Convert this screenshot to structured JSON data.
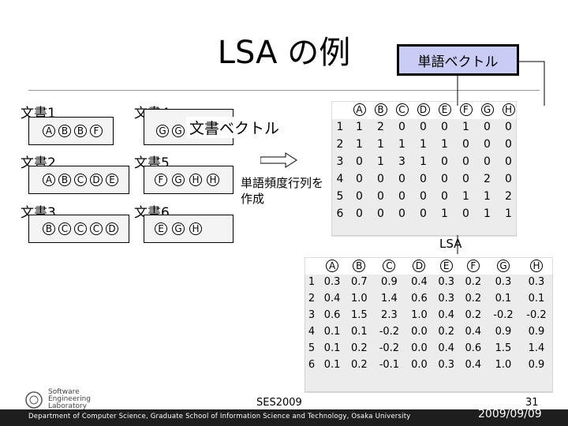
{
  "slide": {
    "title": "LSA の例",
    "callout_word_vector": "単語ベクトル",
    "doc_vector_label": "文書ベクトル",
    "freq_matrix_label_1": "単語頻度行列を",
    "freq_matrix_label_2": "作成",
    "lsa_label": "LSA",
    "ses_label": "SES2009",
    "page_number": "31",
    "footer_text": "Department of Computer Science, Graduate School of Information Science and Technology, Osaka University",
    "date": "2009/09/09"
  },
  "logo": {
    "line1": "Software",
    "line2": "Engineering",
    "line3": "Laboratory"
  },
  "documents": [
    {
      "label": "文書1",
      "words": [
        "A",
        "B",
        "B",
        "F"
      ]
    },
    {
      "label": "文書4",
      "words": [
        "G",
        "G"
      ]
    },
    {
      "label": "文書2",
      "words": [
        "A",
        "B",
        "C",
        "D",
        "E"
      ]
    },
    {
      "label": "文書5",
      "words": [
        "F",
        "G",
        "H",
        "H"
      ]
    },
    {
      "label": "文書3",
      "words": [
        "B",
        "C",
        "C",
        "C",
        "D"
      ]
    },
    {
      "label": "文書6",
      "words": [
        "E",
        "G",
        "H"
      ]
    }
  ],
  "word_matrix": {
    "columns": [
      "A",
      "B",
      "C",
      "D",
      "E",
      "F",
      "G",
      "H"
    ],
    "rows": [
      {
        "label": "1",
        "cells": [
          "1",
          "2",
          "0",
          "0",
          "0",
          "1",
          "0",
          "0"
        ]
      },
      {
        "label": "2",
        "cells": [
          "1",
          "1",
          "1",
          "1",
          "1",
          "0",
          "0",
          "0"
        ]
      },
      {
        "label": "3",
        "cells": [
          "0",
          "1",
          "3",
          "1",
          "0",
          "0",
          "0",
          "0"
        ]
      },
      {
        "label": "4",
        "cells": [
          "0",
          "0",
          "0",
          "0",
          "0",
          "0",
          "2",
          "0"
        ]
      },
      {
        "label": "5",
        "cells": [
          "0",
          "0",
          "0",
          "0",
          "0",
          "1",
          "1",
          "2"
        ]
      },
      {
        "label": "6",
        "cells": [
          "0",
          "0",
          "0",
          "0",
          "1",
          "0",
          "1",
          "1"
        ]
      }
    ]
  },
  "lsa_matrix": {
    "columns": [
      "A",
      "B",
      "C",
      "D",
      "E",
      "F",
      "G",
      "H"
    ],
    "rows": [
      {
        "label": "1",
        "cells": [
          "0.3",
          "0.7",
          "0.9",
          "0.4",
          "0.3",
          "0.2",
          "0.3",
          "0.3"
        ]
      },
      {
        "label": "2",
        "cells": [
          "0.4",
          "1.0",
          "1.4",
          "0.6",
          "0.3",
          "0.2",
          "0.1",
          "0.1"
        ]
      },
      {
        "label": "3",
        "cells": [
          "0.6",
          "1.5",
          "2.3",
          "1.0",
          "0.4",
          "0.2",
          "-0.2",
          "-0.2"
        ]
      },
      {
        "label": "4",
        "cells": [
          "0.1",
          "0.1",
          "-0.2",
          "0.0",
          "0.2",
          "0.4",
          "0.9",
          "0.9"
        ]
      },
      {
        "label": "5",
        "cells": [
          "0.1",
          "0.2",
          "-0.2",
          "0.0",
          "0.4",
          "0.6",
          "1.5",
          "1.4"
        ]
      },
      {
        "label": "6",
        "cells": [
          "0.1",
          "0.2",
          "-0.1",
          "0.0",
          "0.3",
          "0.4",
          "1.0",
          "0.9"
        ]
      }
    ]
  },
  "colors": {
    "callout_fill": "#c9cdf5",
    "bottom_bar": "#1e1e1e",
    "grid_shade": "#e6e6e6"
  }
}
